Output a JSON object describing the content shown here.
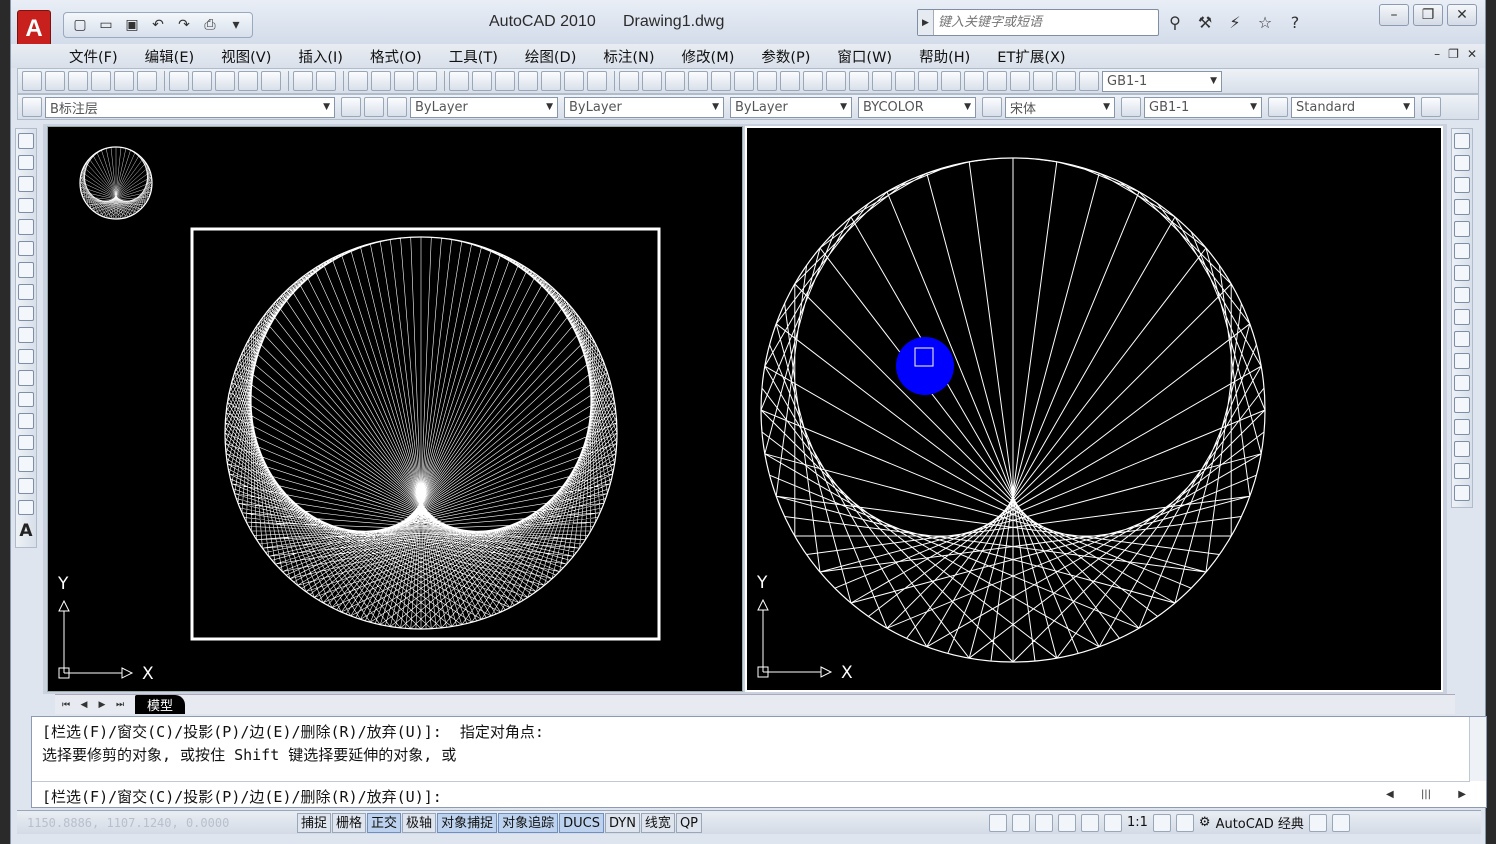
{
  "app": {
    "title": "AutoCAD 2010",
    "file": "Drawing1.dwg",
    "search_placeholder": "键入关键字或短语"
  },
  "menu": [
    "文件(F)",
    "编辑(E)",
    "视图(V)",
    "插入(I)",
    "格式(O)",
    "工具(T)",
    "绘图(D)",
    "标注(N)",
    "修改(M)",
    "参数(P)",
    "窗口(W)",
    "帮助(H)",
    "ET扩展(X)"
  ],
  "toolbar1": {
    "dim_style": "GB1-1"
  },
  "toolbar2": {
    "layer": "B标注层",
    "color": "ByLayer",
    "linetype": "ByLayer",
    "lineweight": "ByLayer",
    "plotstyle": "BYCOLOR",
    "text_font": "宋体",
    "dim_style": "GB1-1",
    "table_style": "Standard"
  },
  "viewport_left": {
    "ucs_x": "X",
    "ucs_y": "Y"
  },
  "viewport_right": {
    "ucs_x": "X",
    "ucs_y": "Y"
  },
  "tabs": {
    "model": "模型"
  },
  "command": {
    "line1": "[栏选(F)/窗交(C)/投影(P)/边(E)/删除(R)/放弃(U)]:  指定对角点:",
    "line2": "选择要修剪的对象, 或按住 Shift 键选择要延伸的对象, 或",
    "prompt": "[栏选(F)/窗交(C)/投影(P)/边(E)/删除(R)/放弃(U)]:"
  },
  "status": {
    "coords": "1150.8886, 1107.1240, 0.0000",
    "toggles": [
      {
        "label": "捕捉",
        "on": false
      },
      {
        "label": "栅格",
        "on": false
      },
      {
        "label": "正交",
        "on": true
      },
      {
        "label": "极轴",
        "on": false
      },
      {
        "label": "对象捕捉",
        "on": true
      },
      {
        "label": "对象追踪",
        "on": true
      },
      {
        "label": "DUCS",
        "on": true
      },
      {
        "label": "DYN",
        "on": false
      },
      {
        "label": "线宽",
        "on": false
      },
      {
        "label": "QP",
        "on": false
      }
    ],
    "scale": "1:1",
    "workspace": "AutoCAD 经典"
  },
  "colors": {
    "canvas": "#000000",
    "geometry": "#ffffff",
    "cursor_blob": "#0000ff"
  }
}
